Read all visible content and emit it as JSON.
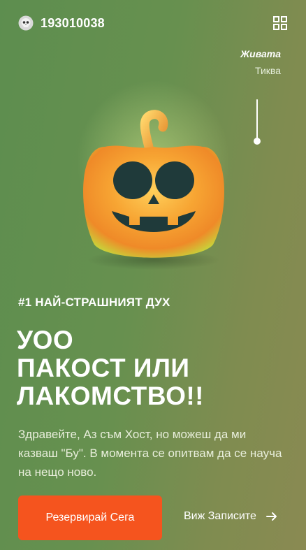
{
  "header": {
    "user_id": "193010038"
  },
  "tags": {
    "title": "Живата",
    "subtitle": "Тиква"
  },
  "hero": {
    "tagline": "#1 НАЙ-СТРАШНИЯТ ДУХ",
    "headline_lines": [
      "УОО",
      "ПАКОСТ ИЛИ",
      "ЛАКОМСТВО!!"
    ],
    "description": "Здравейте, Аз съм Хост, но можеш да ми казваш \"Бу\". В момента се опитвам да се науча на нещо ново."
  },
  "actions": {
    "primary_label": "Резервирай Сега",
    "secondary_label": "Виж Записите"
  },
  "icons": {
    "avatar": "skull-icon",
    "menu": "grid-icon",
    "arrow": "arrow-right-icon"
  },
  "colors": {
    "accent": "#f5541e",
    "background_start": "#5d8e4f",
    "background_end": "#8a8a52"
  }
}
